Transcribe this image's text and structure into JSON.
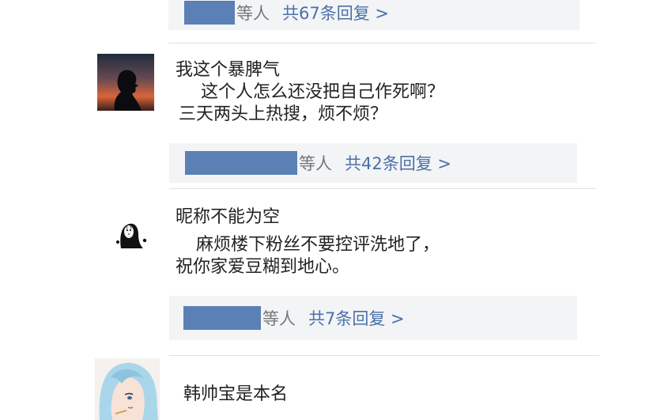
{
  "thread_top": {
    "who_label": "等人",
    "reply_count_label": "共67条回复 >"
  },
  "comments": [
    {
      "username": "我这个暴脾气",
      "avatar_icon": "silhouette-sunset-avatar",
      "text_line1": "这个人怎么还没把自己作死啊？",
      "text_line2": "三天两头上热搜，烦不烦？",
      "who_label": "等人",
      "reply_count_label": "共42条回复 >"
    },
    {
      "username": "昵称不能为空",
      "avatar_icon": "no-face-avatar",
      "text_line1": "麻烦楼下粉丝不要控评洗地了，",
      "text_line2": "祝你家爱豆糊到地心。",
      "who_label": "等人",
      "reply_count_label": "共7条回复 >"
    },
    {
      "username": "韩帅宝是本名",
      "avatar_icon": "anime-girl-avatar"
    }
  ],
  "colors": {
    "redaction": "#5b80b5",
    "reply_link": "#4a71a8",
    "reply_bg": "#f3f4f6"
  }
}
